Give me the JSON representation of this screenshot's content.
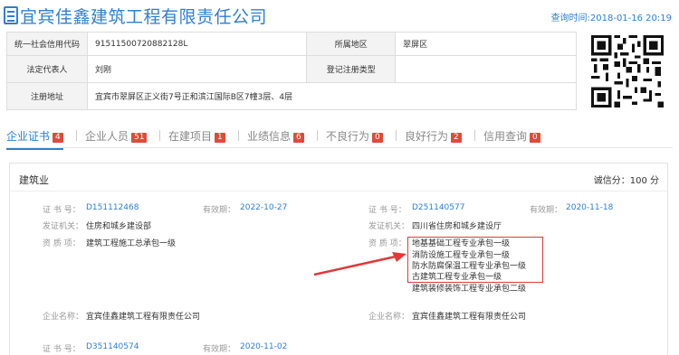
{
  "company": {
    "name": "宜宾佳鑫建筑工程有限责任公司",
    "query_time": "查询时间:2018-01-16 20:19"
  },
  "info": {
    "credit_code_label": "统一社会信用代码",
    "credit_code": "91511500720882128L",
    "region_label": "所属地区",
    "region": "翠屏区",
    "legal_rep_label": "法定代表人",
    "legal_rep": "刘刚",
    "reg_type_label": "登记注册类型",
    "reg_type": "",
    "address_label": "注册地址",
    "address": "宜宾市翠屏区正义街7号正和滨江国际B区7幢3层、4层"
  },
  "tabs": [
    {
      "label": "企业证书",
      "count": "4"
    },
    {
      "label": "企业人员",
      "count": "51"
    },
    {
      "label": "在建项目",
      "count": "1"
    },
    {
      "label": "业绩信息",
      "count": "6"
    },
    {
      "label": "不良行为",
      "count": "0"
    },
    {
      "label": "良好行为",
      "count": "2"
    },
    {
      "label": "信用查询",
      "count": "0"
    }
  ],
  "panel": {
    "title": "建筑业",
    "score": "诚信分：100 分"
  },
  "labels": {
    "cert_no": "证 书 号：",
    "valid": "有效期：",
    "issuer": "发证机关：",
    "qual": "资 质 项：",
    "company_name": "企业名称："
  },
  "certs": [
    {
      "cert_no": "D151112468",
      "valid": "2022-10-27",
      "issuer": "住房和城乡建设部",
      "quals": [
        "建筑工程施工总承包一级"
      ],
      "company": "宜宾佳鑫建筑工程有限责任公司"
    },
    {
      "cert_no": "D251140577",
      "valid": "2020-11-18",
      "issuer": "四川省住房和城乡建设厅",
      "quals": [
        "地基基础工程专业承包一级",
        "消防设施工程专业承包一级",
        "防水防腐保温工程专业承包一级",
        "古建筑工程专业承包一级",
        "建筑装修装饰工程专业承包二级"
      ],
      "company": "宜宾佳鑫建筑工程有限责任公司"
    },
    {
      "cert_no": "D351140574",
      "valid": "2020-11-02"
    }
  ],
  "colors": {
    "primary": "#2f7fd0",
    "badge": "#e04a3a",
    "highlight": "#e03a3a"
  }
}
